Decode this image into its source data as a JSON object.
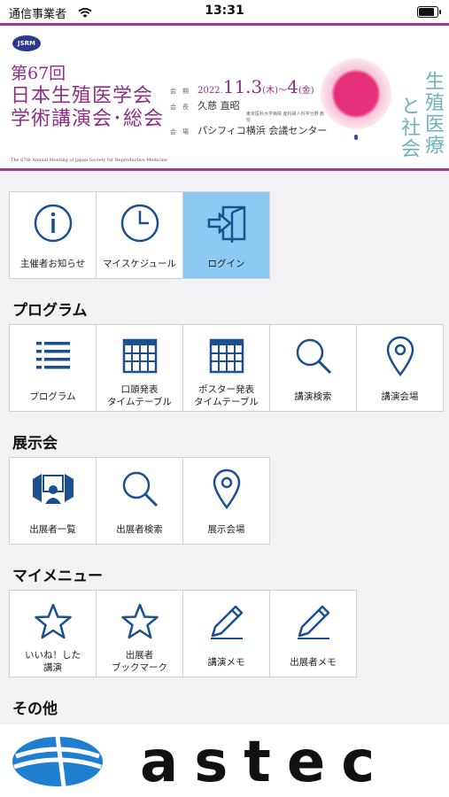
{
  "status_bar": {
    "carrier": "通信事業者",
    "time": "13:31"
  },
  "banner": {
    "logo_text": "JSRM",
    "title_line1": "第67回",
    "title_line2": "日本生殖医学会",
    "title_line3": "学術講演会･総会",
    "subtitle": "The 67th Annual Meeting of Japan Society for Reproductive Medicine",
    "dates_label": "会　期",
    "dates_year": "2022.",
    "dates_main": "11.3",
    "dates_mid": "(木)～",
    "dates_end": "4",
    "dates_tail": "(金)",
    "chair_label": "会　長",
    "chair_name": "久慈 直昭",
    "chair_affil": "東京医科大学病院 産科婦人科学分野 教授",
    "venue_label": "会　場",
    "venue_name": "パシフィコ横浜 会議センター",
    "theme_col1": "生殖医療",
    "theme_col2": "と社会"
  },
  "top_tiles": [
    {
      "label": "主催者お知らせ",
      "icon": "info-icon"
    },
    {
      "label": "マイスケジュール",
      "icon": "clock-icon"
    },
    {
      "label": "ログイン",
      "icon": "login-icon",
      "active": true
    }
  ],
  "sections": {
    "program": {
      "title": "プログラム",
      "tiles": [
        {
          "label": "プログラム",
          "icon": "list-icon"
        },
        {
          "label1": "口頭発表",
          "label2": "タイムテーブル",
          "icon": "calendar-grid-icon"
        },
        {
          "label1": "ポスター発表",
          "label2": "タイムテーブル",
          "icon": "calendar-grid-icon"
        },
        {
          "label": "講演検索",
          "icon": "search-icon"
        },
        {
          "label": "講演会場",
          "icon": "map-pin-icon"
        }
      ]
    },
    "exhibit": {
      "title": "展示会",
      "tiles": [
        {
          "label": "出展者一覧",
          "icon": "exhibitor-icon"
        },
        {
          "label": "出展者検索",
          "icon": "search-icon"
        },
        {
          "label": "展示会場",
          "icon": "map-pin-icon"
        }
      ]
    },
    "mymenu": {
      "title": "マイメニュー",
      "tiles": [
        {
          "label1": "いいね！した",
          "label2": "講演",
          "icon": "star-icon"
        },
        {
          "label1": "出展者",
          "label2": "ブックマーク",
          "icon": "star-icon"
        },
        {
          "label": "講演メモ",
          "icon": "pencil-icon"
        },
        {
          "label": "出展者メモ",
          "icon": "pencil-icon"
        }
      ]
    },
    "other": {
      "title": "その他"
    }
  },
  "footer": {
    "brand": "astec"
  },
  "colors": {
    "accent": "#8e2e86",
    "icon": "#1b4f8f",
    "active_tile": "#8ccaf2"
  }
}
